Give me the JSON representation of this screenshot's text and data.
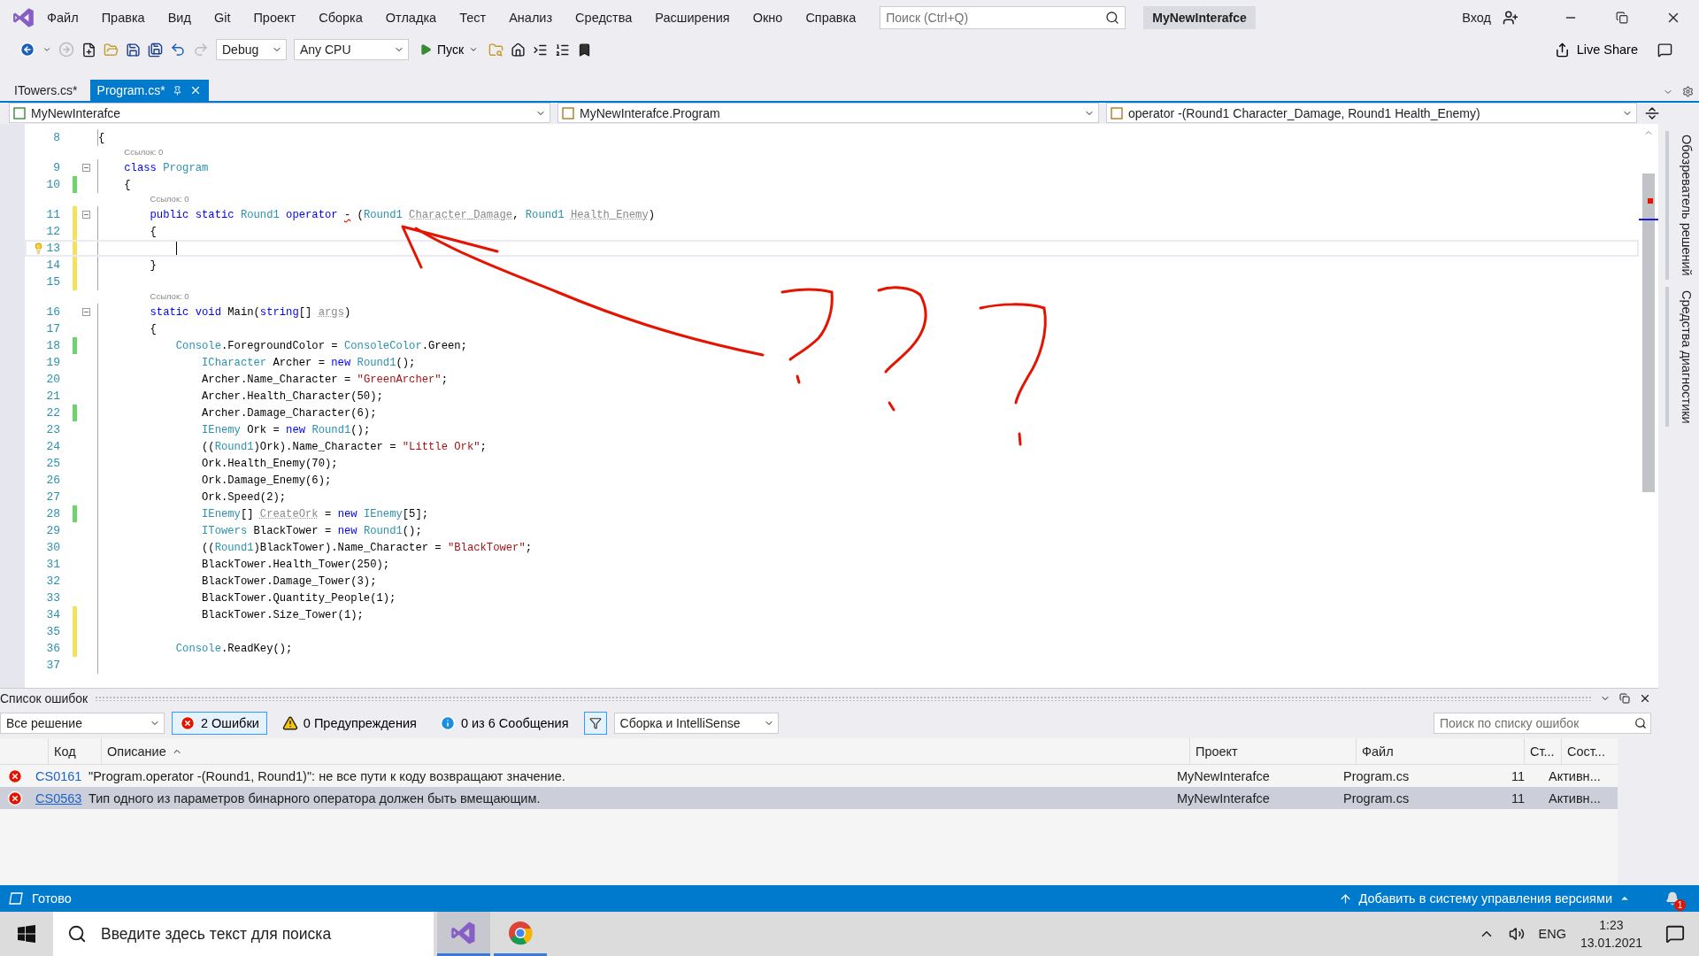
{
  "menu": [
    "Файл",
    "Правка",
    "Вид",
    "Git",
    "Проект",
    "Сборка",
    "Отладка",
    "Тест",
    "Анализ",
    "Средства",
    "Расширения",
    "Окно",
    "Справка"
  ],
  "search": {
    "placeholder": "Поиск (Ctrl+Q)"
  },
  "solution_name": "MyNewInterafce",
  "account": "Вход",
  "toolbar": {
    "configuration": "Debug",
    "platform": "Any CPU",
    "start": "Пуск",
    "live_share": "Live Share"
  },
  "tabs": [
    {
      "label": "ITowers.cs*",
      "selected": false
    },
    {
      "label": "Program.cs*",
      "selected": true
    }
  ],
  "nav": [
    "MyNewInterafce",
    "MyNewInterafce.Program",
    "operator -(Round1 Character_Damage, Round1 Health_Enemy)"
  ],
  "code_lines": [
    {
      "num": "8",
      "tokens": [
        {
          "t": "{",
          "kind": "plain"
        }
      ]
    },
    {
      "num": "9",
      "lens": "Ссылок: 0",
      "fold": true,
      "tokens": [
        {
          "t": "    class ",
          "kind": "kw"
        },
        {
          "t": "Program",
          "kind": "type"
        }
      ]
    },
    {
      "num": "10",
      "changed": true,
      "saved": true,
      "tokens": [
        {
          "t": "    {",
          "kind": "plain"
        }
      ]
    },
    {
      "num": "11",
      "lens": "Ссылок: 0",
      "fold": true,
      "changed": true,
      "saved": false,
      "tokens": [
        {
          "t": "        public static ",
          "kind": "kw"
        },
        {
          "t": "Round1",
          "kind": "type"
        },
        {
          "t": " operator ",
          "kind": "kw"
        },
        {
          "t": "-",
          "kind": "err"
        },
        {
          "t": " (",
          "kind": "plain"
        },
        {
          "t": "Round1 ",
          "kind": "type"
        },
        {
          "t": "Character_Damage",
          "kind": "unused"
        },
        {
          "t": ", ",
          "kind": "plain"
        },
        {
          "t": "Round1 ",
          "kind": "type"
        },
        {
          "t": "Health_Enemy",
          "kind": "unused"
        },
        {
          "t": ")",
          "kind": "plain"
        }
      ]
    },
    {
      "num": "12",
      "changed": true,
      "saved": false,
      "tokens": [
        {
          "t": "        {",
          "kind": "plain"
        }
      ]
    },
    {
      "num": "13",
      "changed": true,
      "saved": false,
      "current": true,
      "bulb": true
    },
    {
      "num": "14",
      "changed": true,
      "saved": false,
      "tokens": [
        {
          "t": "        }",
          "kind": "plain"
        }
      ]
    },
    {
      "num": "15",
      "changed": true,
      "saved": false
    },
    {
      "num": "16",
      "lens": "Ссылок: 0",
      "fold": true,
      "tokens": [
        {
          "t": "        static void",
          "kind": "kw"
        },
        {
          "t": " Main(",
          "kind": "plain"
        },
        {
          "t": "string",
          "kind": "kw"
        },
        {
          "t": "[] ",
          "kind": "plain"
        },
        {
          "t": "args",
          "kind": "unused"
        },
        {
          "t": ")",
          "kind": "plain"
        }
      ]
    },
    {
      "num": "17",
      "tokens": [
        {
          "t": "        {",
          "kind": "plain"
        }
      ]
    },
    {
      "num": "18",
      "changed": true,
      "saved": true,
      "tokens": [
        {
          "t": "            Console",
          "kind": "type"
        },
        {
          "t": ".ForegroundColor = ",
          "kind": "plain"
        },
        {
          "t": "ConsoleColor",
          "kind": "type"
        },
        {
          "t": ".Green;",
          "kind": "plain"
        }
      ]
    },
    {
      "num": "19",
      "tokens": [
        {
          "t": "                ICharacter",
          "kind": "type"
        },
        {
          "t": " Archer = ",
          "kind": "plain"
        },
        {
          "t": "new ",
          "kind": "kw"
        },
        {
          "t": "Round1",
          "kind": "type"
        },
        {
          "t": "();",
          "kind": "plain"
        }
      ]
    },
    {
      "num": "20",
      "tokens": [
        {
          "t": "                Archer.Name_Character = ",
          "kind": "plain"
        },
        {
          "t": "\"GreenArcher\"",
          "kind": "str"
        },
        {
          "t": ";",
          "kind": "plain"
        }
      ]
    },
    {
      "num": "21",
      "tokens": [
        {
          "t": "                Archer.Health_Character(50);",
          "kind": "plain"
        }
      ]
    },
    {
      "num": "22",
      "changed": true,
      "saved": true,
      "tokens": [
        {
          "t": "                Archer.Damage_Character(6);",
          "kind": "plain"
        }
      ]
    },
    {
      "num": "23",
      "tokens": [
        {
          "t": "                IEnemy",
          "kind": "type"
        },
        {
          "t": " Ork = ",
          "kind": "plain"
        },
        {
          "t": "new ",
          "kind": "kw"
        },
        {
          "t": "Round1",
          "kind": "type"
        },
        {
          "t": "();",
          "kind": "plain"
        }
      ]
    },
    {
      "num": "24",
      "tokens": [
        {
          "t": "                ((",
          "kind": "plain"
        },
        {
          "t": "Round1",
          "kind": "type"
        },
        {
          "t": ")Ork).Name_Character = ",
          "kind": "plain"
        },
        {
          "t": "\"Little Ork\"",
          "kind": "str"
        },
        {
          "t": ";",
          "kind": "plain"
        }
      ]
    },
    {
      "num": "25",
      "tokens": [
        {
          "t": "                Ork.Health_Enemy(70);",
          "kind": "plain"
        }
      ]
    },
    {
      "num": "26",
      "tokens": [
        {
          "t": "                Ork.Damage_Enemy(6);",
          "kind": "plain"
        }
      ]
    },
    {
      "num": "27",
      "tokens": [
        {
          "t": "                Ork.Speed(2);",
          "kind": "plain"
        }
      ]
    },
    {
      "num": "28",
      "changed": true,
      "saved": true,
      "tokens": [
        {
          "t": "                IEnemy",
          "kind": "type"
        },
        {
          "t": "[] ",
          "kind": "plain"
        },
        {
          "t": "CreateOrk",
          "kind": "unused"
        },
        {
          "t": " = ",
          "kind": "plain"
        },
        {
          "t": "new ",
          "kind": "kw"
        },
        {
          "t": "IEnemy",
          "kind": "type"
        },
        {
          "t": "[5];",
          "kind": "plain"
        }
      ]
    },
    {
      "num": "29",
      "tokens": [
        {
          "t": "                ITowers",
          "kind": "type"
        },
        {
          "t": " BlackTower = ",
          "kind": "plain"
        },
        {
          "t": "new ",
          "kind": "kw"
        },
        {
          "t": "Round1",
          "kind": "type"
        },
        {
          "t": "();",
          "kind": "plain"
        }
      ]
    },
    {
      "num": "30",
      "tokens": [
        {
          "t": "                ((",
          "kind": "plain"
        },
        {
          "t": "Round1",
          "kind": "type"
        },
        {
          "t": ")BlackTower).Name_Character = ",
          "kind": "plain"
        },
        {
          "t": "\"BlackTower\"",
          "kind": "str"
        },
        {
          "t": ";",
          "kind": "plain"
        }
      ]
    },
    {
      "num": "31",
      "tokens": [
        {
          "t": "                BlackTower.Health_Tower(250);",
          "kind": "plain"
        }
      ]
    },
    {
      "num": "32",
      "tokens": [
        {
          "t": "                BlackTower.Damage_Tower(3);",
          "kind": "plain"
        }
      ]
    },
    {
      "num": "33",
      "tokens": [
        {
          "t": "                BlackTower.Quantity_People(1);",
          "kind": "plain"
        }
      ]
    },
    {
      "num": "34",
      "changed": true,
      "saved": false,
      "tokens": [
        {
          "t": "                BlackTower.Size_Tower(1);",
          "kind": "plain"
        }
      ]
    },
    {
      "num": "35",
      "changed": true,
      "saved": false
    },
    {
      "num": "36",
      "changed": true,
      "saved": false,
      "tokens": [
        {
          "t": "            Console",
          "kind": "type"
        },
        {
          "t": ".ReadKey();",
          "kind": "plain"
        }
      ]
    },
    {
      "num": "37"
    }
  ],
  "side_tabs": [
    "Обозреватель решений",
    "Средства диагностики"
  ],
  "error_list": {
    "title": "Список ошибок",
    "scope": "Все решение",
    "filters": [
      {
        "kind": "error",
        "label": "2 Ошибки",
        "selected": true
      },
      {
        "kind": "warning",
        "label": "0 Предупреждения",
        "selected": false
      },
      {
        "kind": "info",
        "label": "0 из 6 Сообщения",
        "selected": false
      }
    ],
    "source": "Сборка и IntelliSense",
    "search_placeholder": "Поиск по списку ошибок",
    "columns": [
      "Код",
      "Описание",
      "Проект",
      "Файл",
      "Ст...",
      "Сост..."
    ],
    "rows": [
      {
        "code": "CS0161",
        "description": "\"Program.operator -(Round1, Round1)\": не все пути к коду возвращают значение.",
        "project": "MyNewInterafce",
        "file": "Program.cs",
        "line": "11",
        "state": "Активн...",
        "selected": false
      },
      {
        "code": "CS0563",
        "description": "Тип одного из параметров бинарного оператора должен быть вмещающим.",
        "project": "MyNewInterafce",
        "file": "Program.cs",
        "line": "11",
        "state": "Активн...",
        "selected": true
      }
    ]
  },
  "status_bar": {
    "text": "Готово",
    "vcs": "Добавить в систему управления версиями",
    "notifications": "1"
  },
  "taskbar": {
    "search_placeholder": "Введите здесь текст для поиска",
    "language": "ENG",
    "time": "1:23",
    "date": "13.01.2021"
  }
}
